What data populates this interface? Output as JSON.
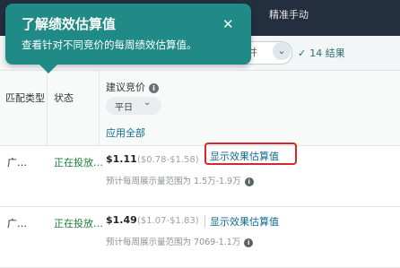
{
  "header": {
    "title_fragment": "精准手动"
  },
  "filter": {
    "select_fragment": "并",
    "results_text": "14 结果",
    "check_glyph": "✓"
  },
  "tooltip": {
    "title": "了解绩效估算值",
    "body": "查看针对不同竞价的每周绩效估算值。",
    "close_glyph": "✕"
  },
  "table": {
    "columns": {
      "match_type": "匹配类型",
      "status": "状态",
      "suggested_bid": "建议竞价"
    },
    "day_select": {
      "value": "平日",
      "chevron": "⌄"
    },
    "apply_all": "应用全部",
    "info_glyph": "i",
    "rows": [
      {
        "match_type": "广…",
        "status": "正在投放…",
        "bid": "$1.11",
        "range": "($0.78-$1.58)",
        "estimate_link": "显示效果估算值",
        "estimate_text": "预计每周展示量范围为 1.5万-1.9万"
      },
      {
        "match_type": "广…",
        "status": "正在投放…",
        "bid": "$1.49",
        "range": "($1.07-$1.83)",
        "estimate_link": "显示效果估算值",
        "estimate_text": "预计每周展示量范围为 7069-1.1万"
      }
    ]
  },
  "colors": {
    "tooltip_bg": "#1f8a86",
    "highlight": "#d9262a",
    "status_green": "#1a7f37",
    "link_blue": "#0f6b8f"
  }
}
